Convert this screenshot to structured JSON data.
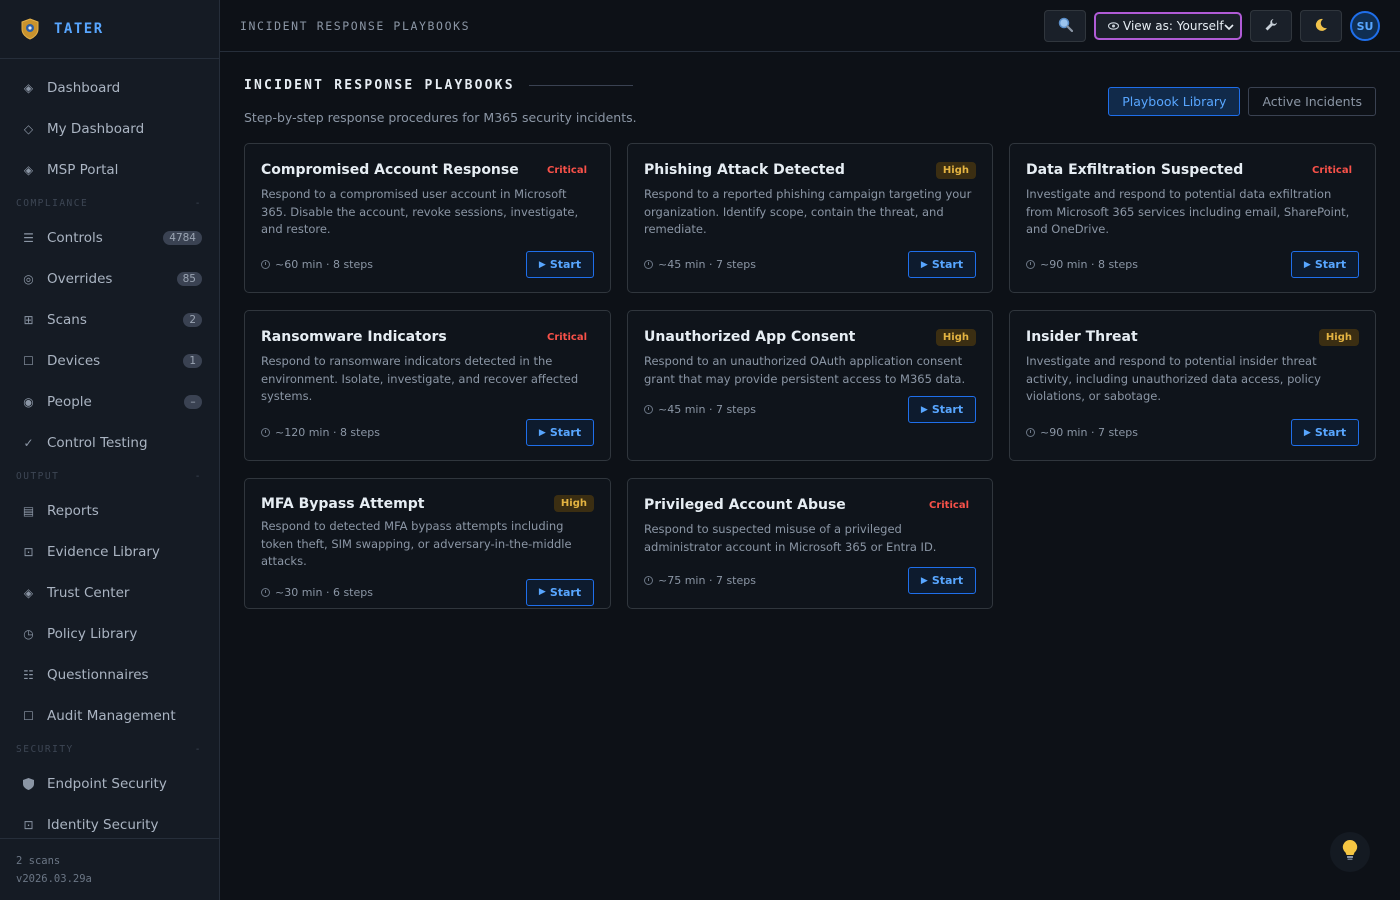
{
  "brand": {
    "name": "TATER"
  },
  "sidebar": {
    "top_items": [
      {
        "label": "Dashboard",
        "icon": "diamond-icon"
      },
      {
        "label": "My Dashboard",
        "icon": "diamond-outline-icon"
      },
      {
        "label": "MSP Portal",
        "icon": "diamond-icon"
      }
    ],
    "sections": [
      {
        "header": "COMPLIANCE",
        "collapse": "-",
        "items": [
          {
            "label": "Controls",
            "icon": "list-icon",
            "badge": "4784"
          },
          {
            "label": "Overrides",
            "icon": "target-icon",
            "badge": "85"
          },
          {
            "label": "Scans",
            "icon": "grid-icon",
            "badge": "2"
          },
          {
            "label": "Devices",
            "icon": "square-icon",
            "badge": "1"
          },
          {
            "label": "People",
            "icon": "radio-icon",
            "badge": "–"
          },
          {
            "label": "Control Testing",
            "icon": "check-icon",
            "badge": ""
          }
        ]
      },
      {
        "header": "OUTPUT",
        "collapse": "-",
        "items": [
          {
            "label": "Reports",
            "icon": "report-icon",
            "badge": ""
          },
          {
            "label": "Evidence Library",
            "icon": "evidence-icon",
            "badge": ""
          },
          {
            "label": "Trust Center",
            "icon": "diamond-icon",
            "badge": ""
          },
          {
            "label": "Policy Library",
            "icon": "clock-icon",
            "badge": ""
          },
          {
            "label": "Questionnaires",
            "icon": "checklist-icon",
            "badge": ""
          },
          {
            "label": "Audit Management",
            "icon": "square-icon",
            "badge": ""
          }
        ]
      },
      {
        "header": "SECURITY",
        "collapse": "-",
        "items": [
          {
            "label": "Endpoint Security",
            "icon": "shield-icon",
            "badge": ""
          },
          {
            "label": "Identity Security",
            "icon": "id-icon",
            "badge": ""
          }
        ]
      }
    ],
    "footer": {
      "scans": "2 scans",
      "version": "v2026.03.29a"
    }
  },
  "topbar": {
    "title": "INCIDENT RESPONSE PLAYBOOKS",
    "view_as": "View as: Yourself",
    "avatar": "SU"
  },
  "main": {
    "title": "INCIDENT RESPONSE PLAYBOOKS",
    "subtitle": "Step-by-step response procedures for M365 security incidents.",
    "tabs": [
      {
        "label": "Playbook Library",
        "active": true
      },
      {
        "label": "Active Incidents",
        "active": false
      }
    ],
    "start_label": "Start",
    "playbooks": [
      {
        "title": "Compromised Account Response",
        "severity": "Critical",
        "desc": "Respond to a compromised user account in Microsoft 365. Disable the account, revoke sessions, investigate, and restore.",
        "meta": "~60 min · 8 steps"
      },
      {
        "title": "Phishing Attack Detected",
        "severity": "High",
        "desc": "Respond to a reported phishing campaign targeting your organization. Identify scope, contain the threat, and remediate.",
        "meta": "~45 min · 7 steps"
      },
      {
        "title": "Data Exfiltration Suspected",
        "severity": "Critical",
        "desc": "Investigate and respond to potential data exfiltration from Microsoft 365 services including email, SharePoint, and OneDrive.",
        "meta": "~90 min · 8 steps"
      },
      {
        "title": "Ransomware Indicators",
        "severity": "Critical",
        "desc": "Respond to ransomware indicators detected in the environment. Isolate, investigate, and recover affected systems.",
        "meta": "~120 min · 8 steps"
      },
      {
        "title": "Unauthorized App Consent",
        "severity": "High",
        "desc": "Respond to an unauthorized OAuth application consent grant that may provide persistent access to M365 data.",
        "meta": "~45 min · 7 steps"
      },
      {
        "title": "Insider Threat",
        "severity": "High",
        "desc": "Investigate and respond to potential insider threat activity, including unauthorized data access, policy violations, or sabotage.",
        "meta": "~90 min · 7 steps"
      },
      {
        "title": "MFA Bypass Attempt",
        "severity": "High",
        "desc": "Respond to detected MFA bypass attempts including token theft, SIM swapping, or adversary-in-the-middle attacks.",
        "meta": "~30 min · 6 steps"
      },
      {
        "title": "Privileged Account Abuse",
        "severity": "Critical",
        "desc": "Respond to suspected misuse of a privileged administrator account in Microsoft 365 or Entra ID.",
        "meta": "~75 min · 7 steps"
      }
    ]
  },
  "colors": {
    "accent": "#58a6ff",
    "critical": "#f85149",
    "high": "#e3b341",
    "view_border": "#b05bd6"
  }
}
